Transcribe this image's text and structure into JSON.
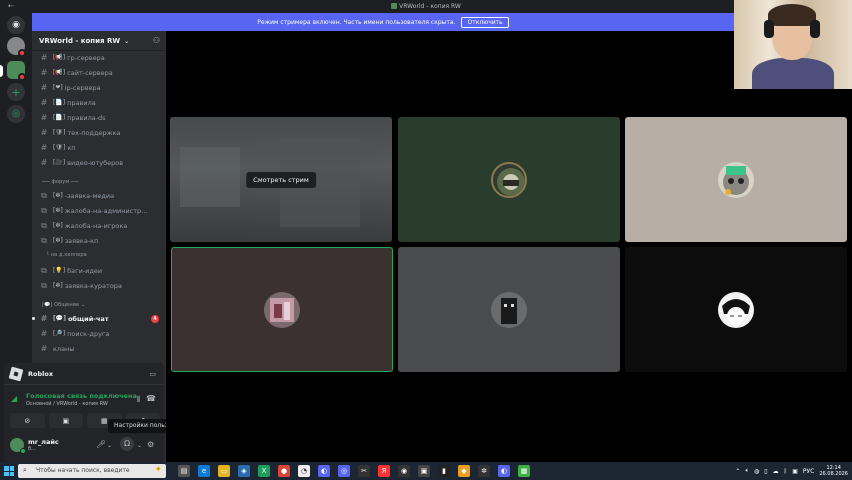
{
  "window": {
    "title": "VRWorld - копия RW"
  },
  "banner": {
    "text": "Режим стримера включен. Часть имени пользователя скрыта.",
    "button": "Отключить"
  },
  "server": {
    "name": "VRWorld - копия RW"
  },
  "channels": [
    {
      "emoji": "[📢]",
      "name": "гр-сервера"
    },
    {
      "emoji": "[📢]",
      "name": "сайт-сервера"
    },
    {
      "emoji": "[❤]",
      "name": "ip-сервера"
    },
    {
      "emoji": "[📄]",
      "name": "правила"
    },
    {
      "emoji": "[📄]",
      "name": "правила-ds"
    },
    {
      "emoji": "[🛡]",
      "name": "тех-поддержка"
    },
    {
      "emoji": "[🛡]",
      "name": "кп"
    },
    {
      "emoji": "[🎥]",
      "name": "видео-ютуберов"
    }
  ],
  "category_forum": "⎯⎯⎯ форум ⎯⎯⎯",
  "forum_channels": [
    {
      "emoji": "[❇]",
      "name": "-заявка-медиа"
    },
    {
      "emoji": "[❇]",
      "name": "жалоба-на-администр..."
    },
    {
      "emoji": "[❇]",
      "name": "жалоба-на-игрока"
    },
    {
      "emoji": "[❇]",
      "name": "заявка-кп"
    }
  ],
  "sub_label": "на д.хелпера",
  "forum_channels_2": [
    {
      "emoji": "[💡]",
      "name": "баги-идеи"
    },
    {
      "emoji": "[❇]",
      "name": "заявка-куратора"
    }
  ],
  "category_chat": "[💬] Общение ⌄",
  "chat_channels": [
    {
      "emoji": "[💬]",
      "name": "общий-чат",
      "mentions": "4"
    },
    {
      "emoji": "[🔎]",
      "name": "поиск-друга"
    },
    {
      "emoji": "",
      "name": "кланы"
    }
  ],
  "activity": {
    "name": "Roblox"
  },
  "voice": {
    "status": "Голосовая связь подключена",
    "channel": "Основной / VRWorld - копия RW"
  },
  "user": {
    "name": "mr_лайс",
    "status": "б..."
  },
  "tooltip": "Настройки пользователя",
  "stage": {
    "watch_label": "Смотреть стрим"
  },
  "taskbar": {
    "search_placeholder": "Чтобы начать поиск, введите",
    "lang": "РУС",
    "time": "12:14",
    "date": "26.08.2026"
  },
  "colors": {
    "blurple": "#5865f2",
    "green": "#23a55a",
    "red": "#f23f43",
    "sidebar": "#2b2d31"
  }
}
